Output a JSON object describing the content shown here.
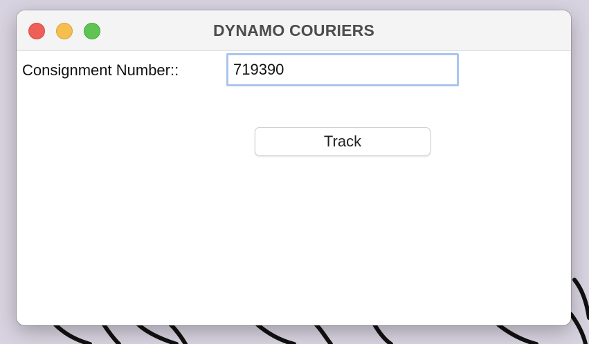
{
  "window": {
    "title": "DYNAMO COURIERS",
    "controls": {
      "close": {
        "color": "#ee5f57"
      },
      "minimize": {
        "color": "#f5be4f"
      },
      "zoom": {
        "color": "#60c454"
      }
    }
  },
  "form": {
    "consignment_label": "Consignment Number::",
    "consignment_value": "719390",
    "track_button_label": "Track"
  },
  "colors": {
    "desktop_background": "#d8d3e0",
    "input_focus_ring": "#a9c4ee"
  },
  "desktop": {
    "wallpaper_icon": "flower-outline-icon"
  }
}
